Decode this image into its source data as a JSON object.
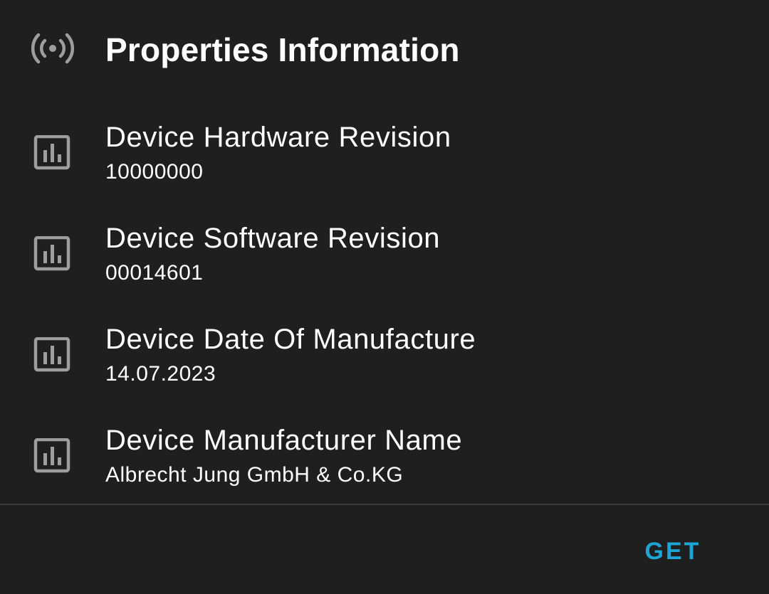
{
  "header": {
    "title": "Properties Information",
    "icon": "broadcast-signal-icon"
  },
  "properties": [
    {
      "icon": "bar-chart-icon",
      "label": "Device Hardware Revision",
      "value": "10000000"
    },
    {
      "icon": "bar-chart-icon",
      "label": "Device Software Revision",
      "value": "00014601"
    },
    {
      "icon": "bar-chart-icon",
      "label": "Device Date Of Manufacture",
      "value": "14.07.2023"
    },
    {
      "icon": "bar-chart-icon",
      "label": "Device Manufacturer Name",
      "value": "Albrecht Jung GmbH & Co.KG"
    }
  ],
  "actions": {
    "get_label": "GET"
  },
  "colors": {
    "background": "#1f1f1f",
    "text": "#ffffff",
    "icon": "#9e9e9e",
    "accent": "#1da5d4",
    "divider": "#3a3a3a"
  }
}
